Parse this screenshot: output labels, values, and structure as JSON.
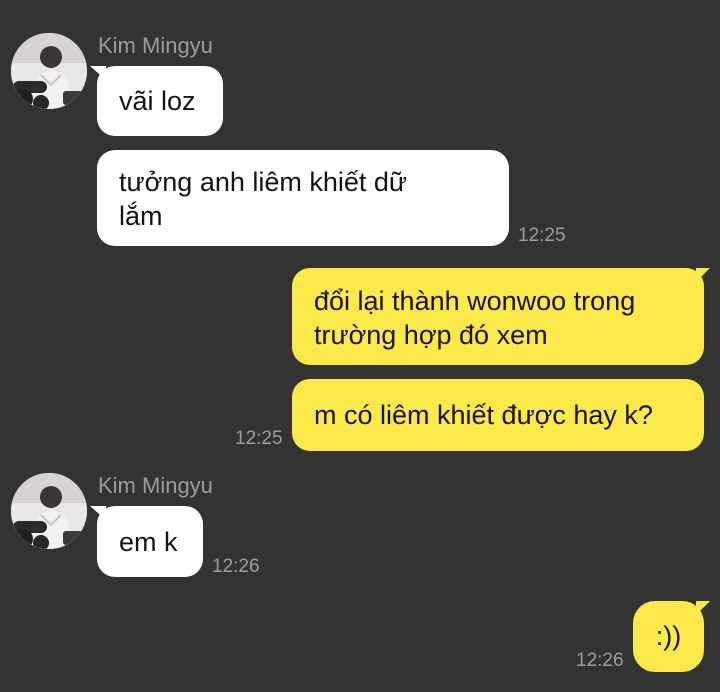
{
  "chat": {
    "group1": {
      "sender": "Kim Mingyu",
      "avatar_icon": "contact-avatar",
      "messages": [
        {
          "text": "vãi loz"
        },
        {
          "line1": "tưởng anh liêm khiết dữ",
          "line2": "lắm"
        }
      ],
      "time": "12:25"
    },
    "group2": {
      "messages": [
        {
          "line1": "đổi lại thành wonwoo trong",
          "line2": "trường hợp đó xem"
        },
        {
          "text": "m có liêm khiết được hay k?"
        }
      ],
      "time": "12:25"
    },
    "group3": {
      "sender": "Kim Mingyu",
      "avatar_icon": "contact-avatar",
      "messages": [
        {
          "text": "em k"
        }
      ],
      "time": "12:26"
    },
    "group4": {
      "messages": [
        {
          "text": ":))"
        }
      ],
      "time": "12:26"
    }
  },
  "colors": {
    "background": "#333332",
    "incoming_bubble": "#ffffff",
    "outgoing_bubble": "#fbe94a",
    "meta_text": "#9c9c9c"
  }
}
